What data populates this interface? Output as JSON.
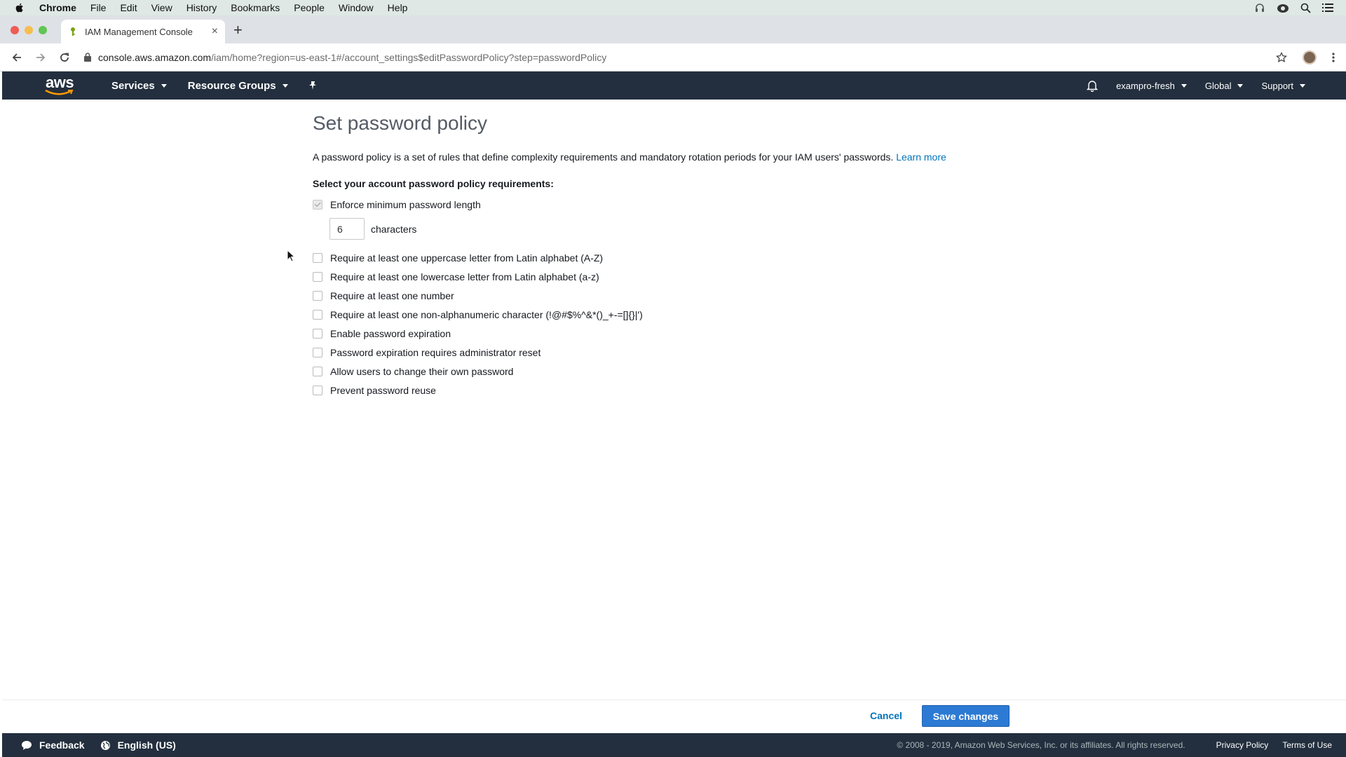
{
  "mac_menubar": {
    "app": "Chrome",
    "items": [
      "File",
      "Edit",
      "View",
      "History",
      "Bookmarks",
      "People",
      "Window",
      "Help"
    ]
  },
  "browser": {
    "tab_title": "IAM Management Console",
    "url_host": "console.aws.amazon.com",
    "url_path": "/iam/home?region=us-east-1#/account_settings$editPasswordPolicy?step=passwordPolicy"
  },
  "aws_header": {
    "logo_text": "aws",
    "services": "Services",
    "resource_groups": "Resource Groups",
    "account": "exampro-fresh",
    "region": "Global",
    "support": "Support"
  },
  "page": {
    "title": "Set password policy",
    "description": "A password policy is a set of rules that define complexity requirements and mandatory rotation periods for your IAM users' passwords.",
    "learn_more": "Learn more",
    "requirements_heading": "Select your account password policy requirements:",
    "enforce_min_length": "Enforce minimum password length",
    "min_length_value": "6",
    "characters_label": "characters",
    "options": [
      {
        "label": "Require at least one uppercase letter from Latin alphabet (A-Z)",
        "checked": false
      },
      {
        "label": "Require at least one lowercase letter from Latin alphabet (a-z)",
        "checked": false
      },
      {
        "label": "Require at least one number",
        "checked": false
      },
      {
        "label": "Require at least one non-alphanumeric character (!@#$%^&*()_+-=[]{}|')",
        "checked": false
      },
      {
        "label": "Enable password expiration",
        "checked": false
      },
      {
        "label": "Password expiration requires administrator reset",
        "checked": false
      },
      {
        "label": "Allow users to change their own password",
        "checked": false
      },
      {
        "label": "Prevent password reuse",
        "checked": false
      }
    ]
  },
  "actions": {
    "cancel": "Cancel",
    "save": "Save changes"
  },
  "footer": {
    "feedback": "Feedback",
    "language": "English (US)",
    "copyright": "© 2008 - 2019, Amazon Web Services, Inc. or its affiliates. All rights reserved.",
    "privacy": "Privacy Policy",
    "terms": "Terms of Use"
  },
  "colors": {
    "aws_nav": "#232f3e",
    "link": "#0073bb",
    "primary_button": "#2c7ad3",
    "aws_orange": "#ff9900"
  }
}
